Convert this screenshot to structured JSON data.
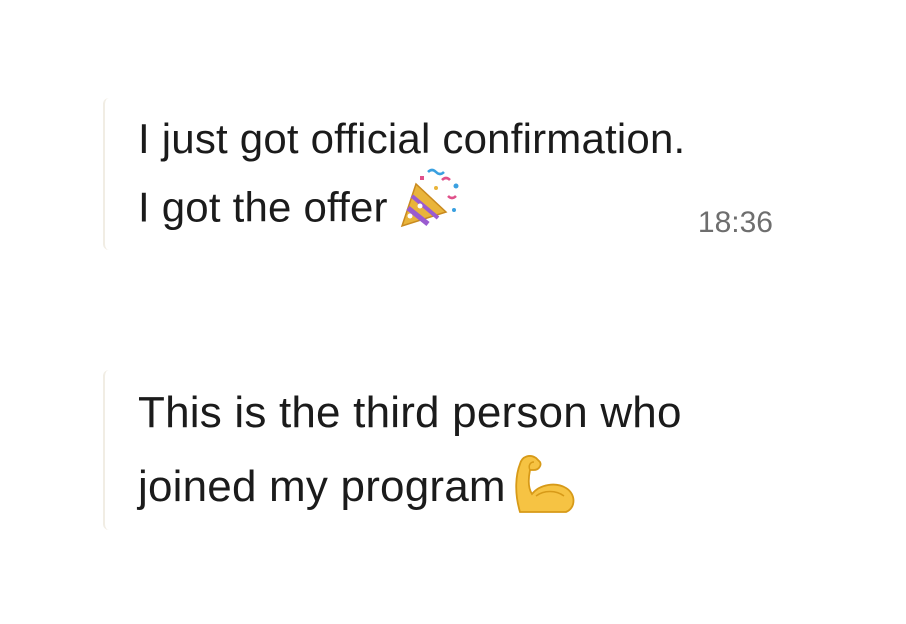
{
  "messages": [
    {
      "lines": [
        "I just got official confirmation.",
        "I got the offer"
      ],
      "emoji": "party-popper-icon",
      "time": "18:36"
    },
    {
      "lines": [
        "This is the third person who",
        "joined my program"
      ],
      "emoji": "flexed-biceps-icon"
    }
  ],
  "colors": {
    "text": "#1b1b1b",
    "timestamp": "#6e6e6e",
    "bubble_edge": "#f1ede4"
  }
}
